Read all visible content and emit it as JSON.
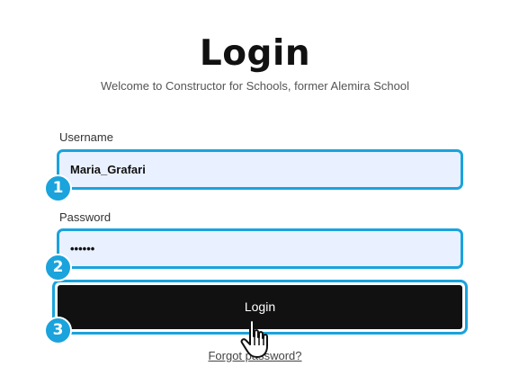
{
  "page": {
    "title": "Login",
    "subtitle": "Welcome to Constructor for Schools, former Alemira School"
  },
  "form": {
    "username_label": "Username",
    "username_value": "Maria_Grafari",
    "password_label": "Password",
    "password_value": "••••••",
    "login_button_label": "Login",
    "forgot_link": "Forgot password?"
  },
  "steps": [
    "1",
    "2",
    "3"
  ],
  "colors": {
    "highlight": "#1aa3dc",
    "field_background": "#e9f0ff",
    "button_background": "#111111",
    "button_text": "#ffffff"
  },
  "icons": {
    "cursor": "pointer-hand-icon"
  }
}
